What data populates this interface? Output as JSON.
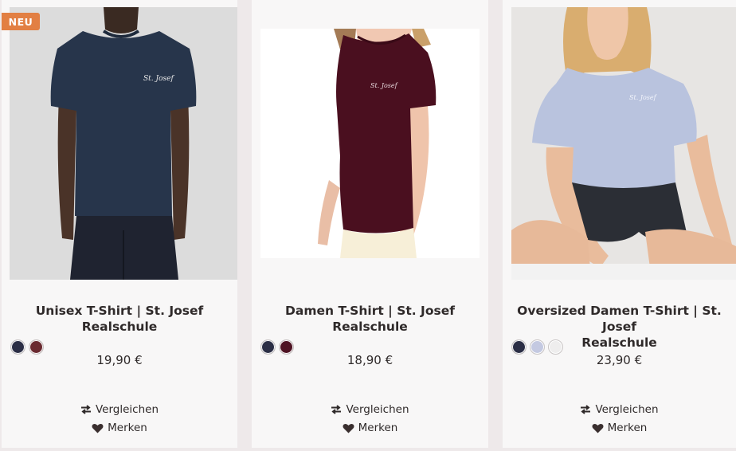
{
  "products": [
    {
      "badge": "NEU",
      "title_line1": "Unisex T-Shirt | St. Josef",
      "title_line2": "Realschule",
      "price": "19,90 €",
      "print_text": "St. Josef",
      "colors": [
        "#2b2e45",
        "#6a2a30"
      ]
    },
    {
      "title_line1": "Damen T-Shirt | St. Josef",
      "title_line2": "Realschule",
      "price": "18,90 €",
      "print_text": "St. Josef",
      "colors": [
        "#2b2e45",
        "#4e1323"
      ]
    },
    {
      "title_line1": "Oversized Damen T-Shirt | St. Josef",
      "title_line2": "Realschule",
      "price": "23,90 €",
      "print_text": "St. Josef",
      "colors": [
        "#2b2e45",
        "#c4c9e1",
        "#eeeded"
      ]
    }
  ],
  "actions": {
    "compare_label": "Vergleichen",
    "wishlist_label": "Merken"
  },
  "icons": {
    "compare": "compare-arrows-icon",
    "wishlist": "heart-icon"
  },
  "colors": {
    "badge": "#e27f43",
    "background": "#eee9ea",
    "card": "#f8f7f7"
  }
}
